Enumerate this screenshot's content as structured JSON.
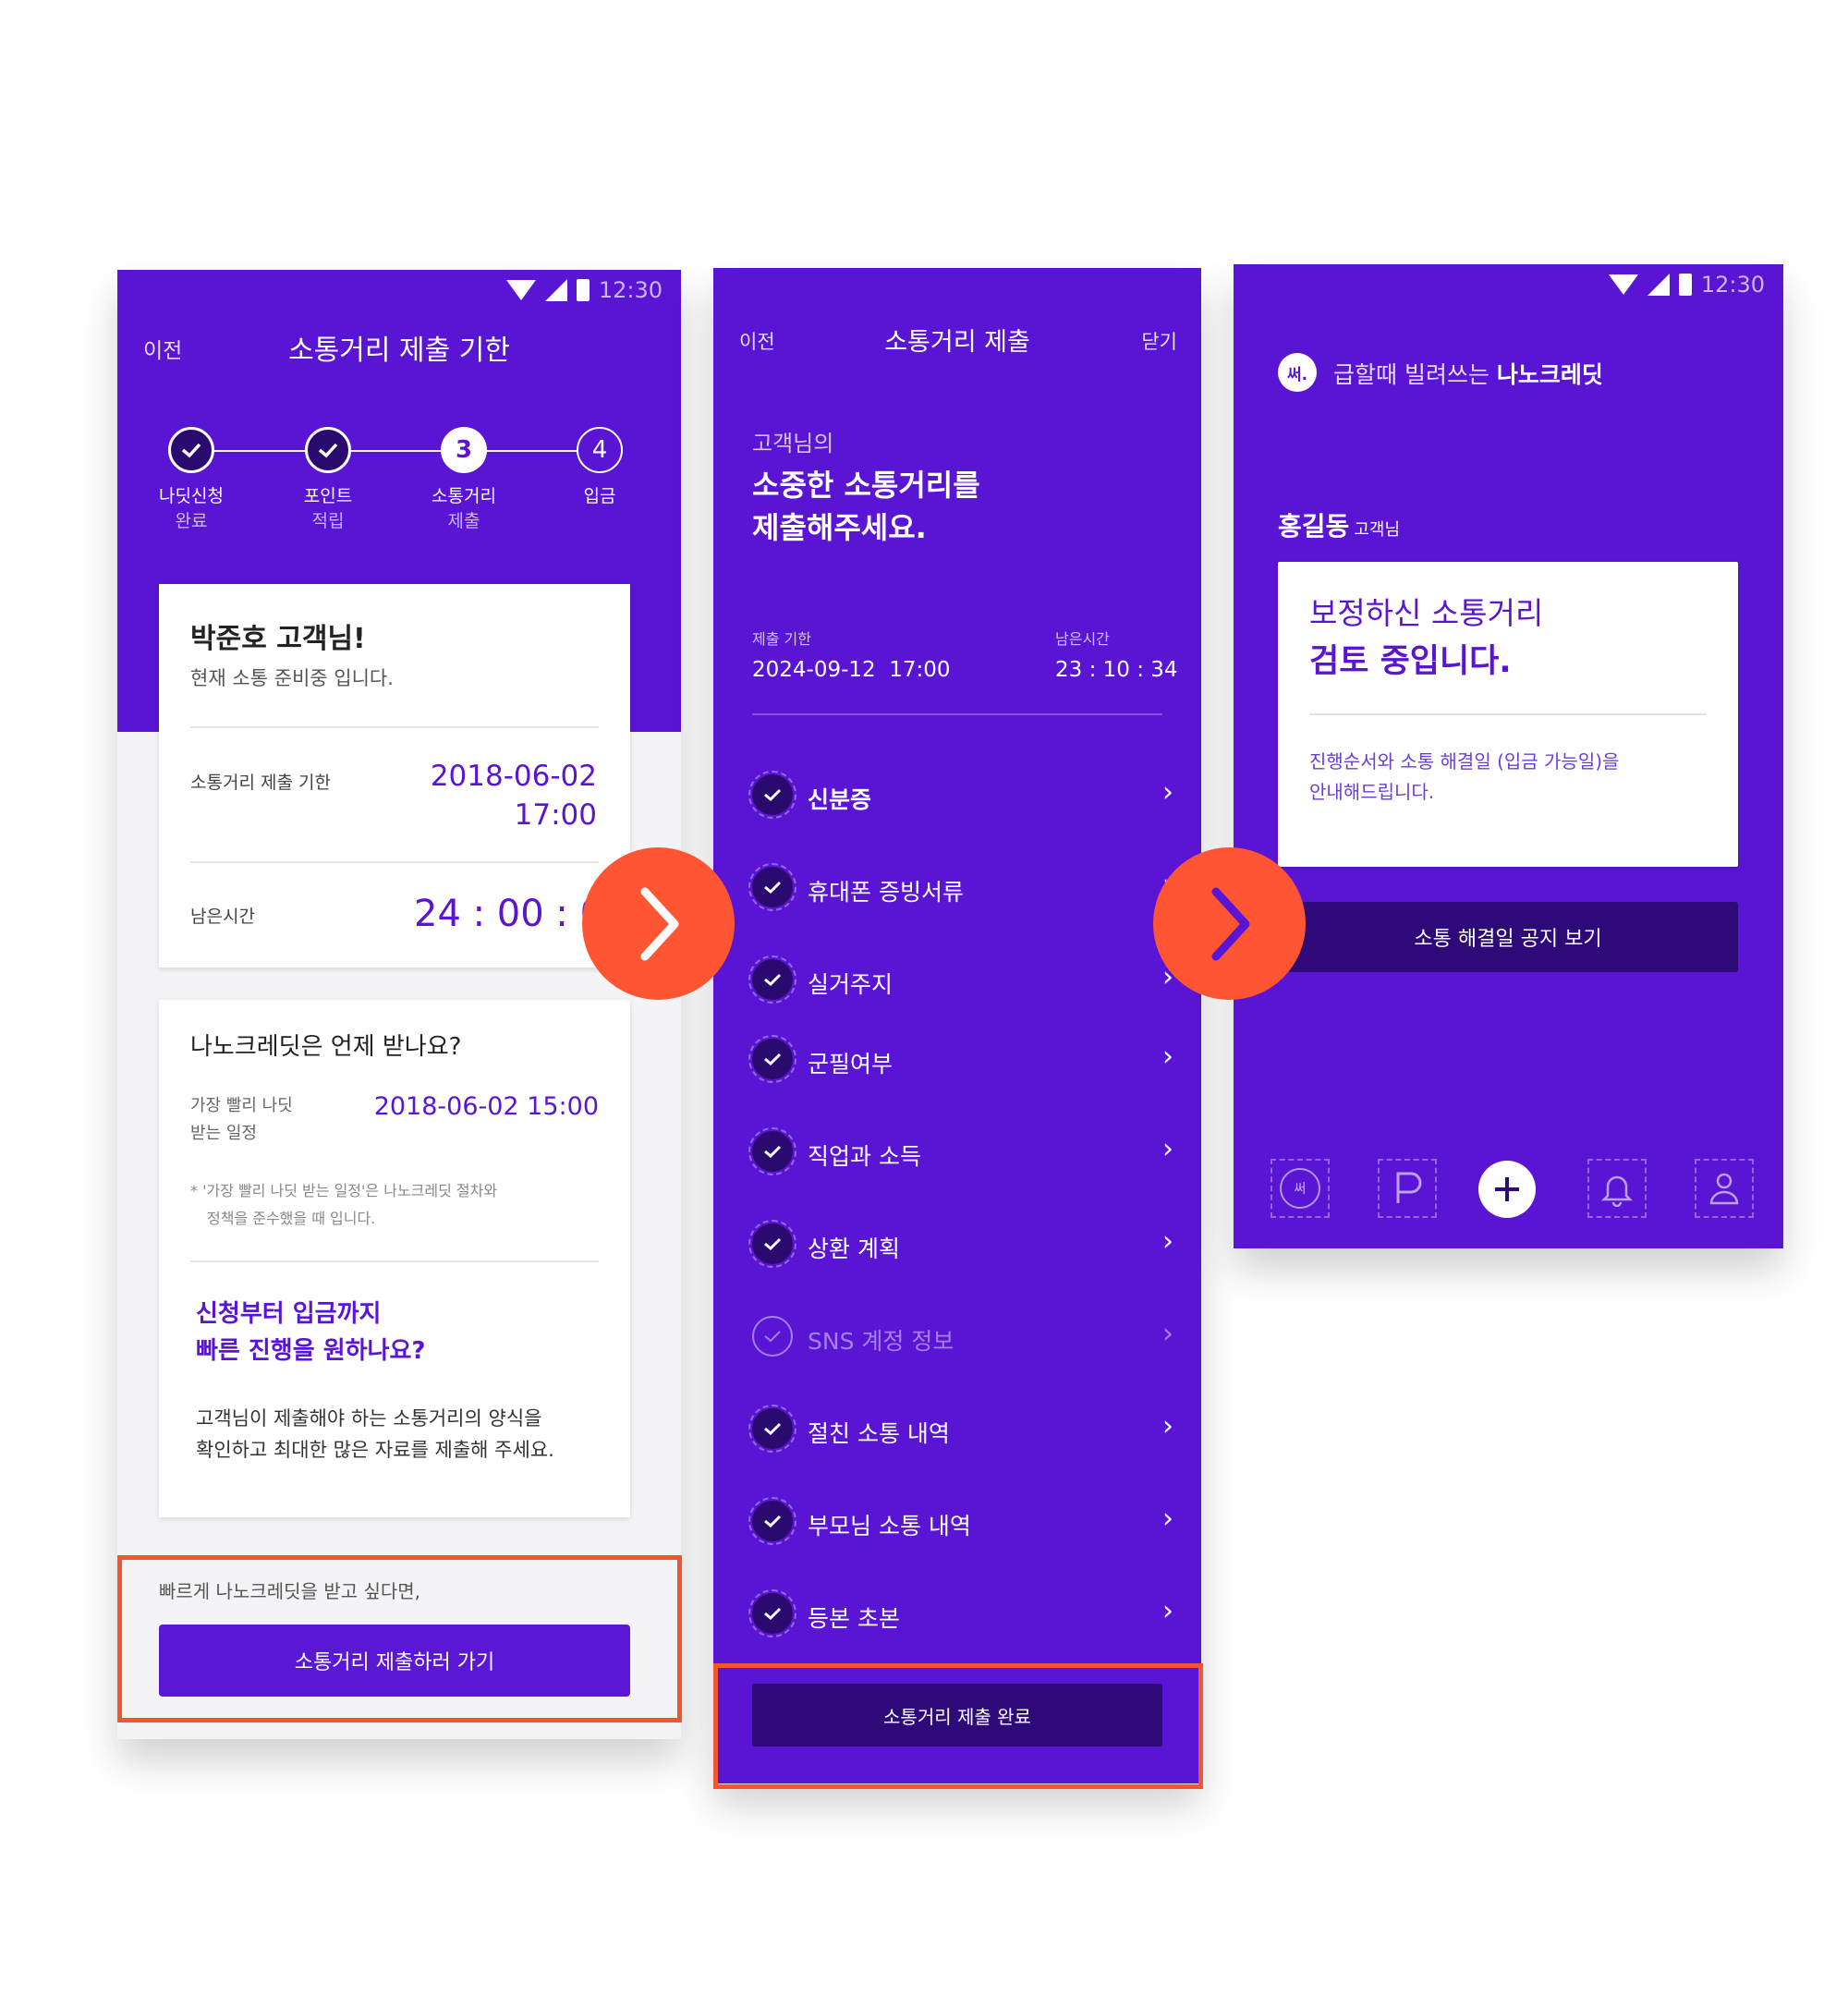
{
  "status": {
    "time": "12:30"
  },
  "screen1": {
    "back": "이전",
    "title": "소통거리 제출 기한",
    "steps": [
      {
        "num": "",
        "label": "나딧신청",
        "sub": "완료",
        "state": "done"
      },
      {
        "num": "",
        "label": "포인트",
        "sub": "적립",
        "state": "done"
      },
      {
        "num": "3",
        "label": "소통거리",
        "sub": "제출",
        "state": "current"
      },
      {
        "num": "4",
        "label": "입금",
        "sub": "",
        "state": "todo"
      }
    ],
    "greeting": "박준호 고객님!",
    "greeting_sub": "현재 소통 준비중 입니다.",
    "deadline_label": "소통거리 제출 기한",
    "deadline_date": "2018-06-02",
    "deadline_time": "17:00",
    "remain_label": "남은시간",
    "remain_value": "24 : 00 : 00",
    "faq_title": "나노크레딧은 언제 받나요?",
    "earliest_label_1": "가장 빨리 나딧",
    "earliest_label_2": "받는 일정",
    "earliest_value": "2018-06-02 15:00",
    "note_1": "* '가장 빨리 나딧 받는 일정'은 나노크레딧 절차와",
    "note_2": "정책을 준수했을 때 입니다.",
    "promo_title_1": "신청부터 입금까지",
    "promo_title_2": "빠른 진행을 원하나요?",
    "promo_body_1": "고객님이 제출해야 하는 소통거리의 양식을",
    "promo_body_2": "확인하고 최대한 많은 자료를 제출해 주세요.",
    "bottom_hint": "빠르게 나노크레딧을 받고 싶다면,",
    "bottom_button": "소통거리 제출하러 가기"
  },
  "screen2": {
    "back": "이전",
    "title": "소통거리 제출",
    "close": "닫기",
    "eyebrow": "고객님의",
    "heading_1": "소중한 소통거리를",
    "heading_2": "제출해주세요.",
    "deadline_label": "제출 기한",
    "deadline_value": "2024-09-12  17:00",
    "remain_label": "남은시간",
    "remain_value": "23 : 10 : 34",
    "items": [
      {
        "label": "신분증",
        "checked": true,
        "bold": true
      },
      {
        "label": "휴대폰 증빙서류",
        "checked": true,
        "bold": false
      },
      {
        "label": "실거주지",
        "checked": true,
        "bold": false
      },
      {
        "label": "군필여부",
        "checked": true,
        "bold": false
      },
      {
        "label": "직업과 소득",
        "checked": true,
        "bold": false
      },
      {
        "label": "상환 계획",
        "checked": true,
        "bold": false
      },
      {
        "label": "SNS 계정 정보",
        "checked": false,
        "bold": false
      },
      {
        "label": "절친 소통 내역",
        "checked": true,
        "bold": false
      },
      {
        "label": "부모님 소통 내역",
        "checked": true,
        "bold": false
      },
      {
        "label": "등본 초본",
        "checked": true,
        "bold": false
      }
    ],
    "submit_button": "소통거리 제출 완료"
  },
  "screen3": {
    "logo_text": "써.",
    "tagline_light": "급할때 빌려쓰는 ",
    "tagline_bold": "나노크레딧",
    "customer_name": "홍길동",
    "customer_suffix": "고객님",
    "card_title_1": "보정하신 소통거리",
    "card_title_2": "검토 중입니다.",
    "card_body_1": "진행순서와 소통 해결일 (입금 가능일)을",
    "card_body_2": "안내해드립니다.",
    "notice_button": "소통 해결일 공지 보기",
    "nav_logo": "써"
  },
  "colors": {
    "brand_purple": "#5915d3",
    "dark_purple": "#2e0a78",
    "arrow_orange": "#ff5533",
    "highlight_red": "#f25532"
  }
}
